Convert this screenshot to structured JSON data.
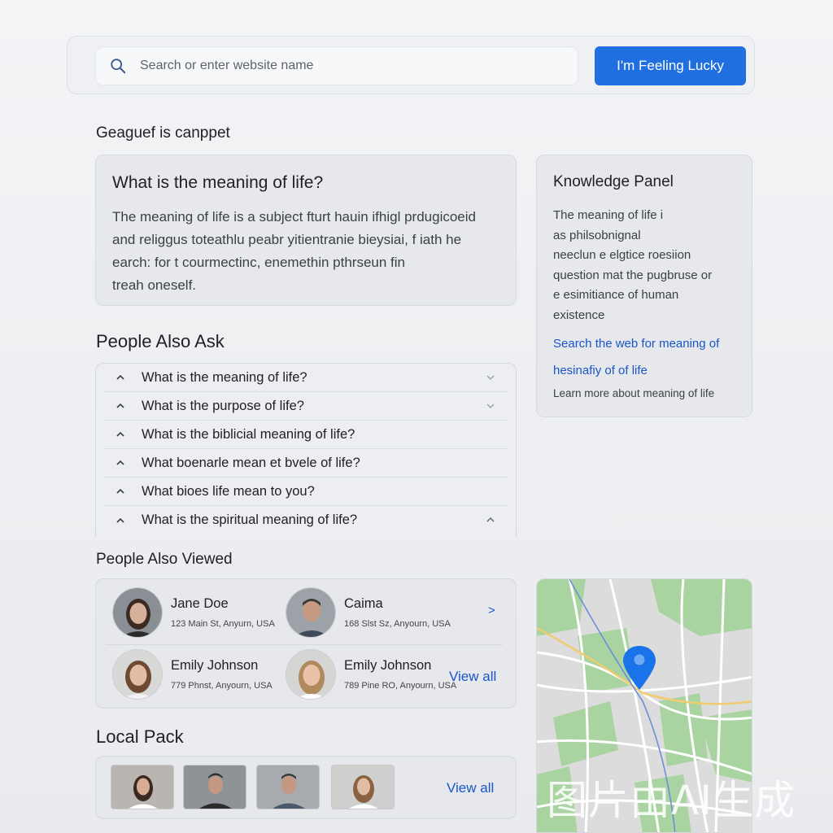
{
  "search": {
    "placeholder": "Search or enter website name",
    "lucky_label": "I'm Feeling Lucky"
  },
  "snippet_heading": "Geaguef is canppet",
  "snippet": {
    "question": "What is the meaning of life?",
    "lines": [
      "The meaning of life is a subject fturt hauin ifhigl prdugicoeid",
      "and religgus toteathlu peabr yitientranie bieysiai, f iath he",
      "earch: for t courmectinc, enemethin pthrseun fin",
      "treah oneself."
    ]
  },
  "knowledge_panel": {
    "title": "Knowledge Panel",
    "lines": [
      "The meaning of life i",
      "as philsobnignal",
      "neeclun e elgtice roesiion",
      "question mat the pugbruse or",
      "e esimitiance of human",
      "existence"
    ],
    "link_search": "Search the web for meaning of",
    "link_second": "hesinafiy of of life",
    "learn_more": "Learn more about meaning of life"
  },
  "people_also_ask": {
    "title": "People Also Ask",
    "questions": [
      "What is the meaning of life?",
      "What is the purpose of life?",
      "What is the biblicial meaning of life?",
      "What boenarle mean et bvele of life?",
      "What bioes life mean to you?",
      "What is the spiritual meaning of life?"
    ]
  },
  "people_also_viewed": {
    "title": "People Also Viewed",
    "people": [
      {
        "name": "Jane Doe",
        "address": "123 Main St, Anyurn, USA"
      },
      {
        "name": "Caima",
        "address": "168 Slst Sz, Anyourn, USA"
      },
      {
        "name": "Emily Johnson",
        "address": "779 Phnst, Anyourn, USA"
      },
      {
        "name": "Emily Johnson",
        "address": "789 Pine RO, Anyourn, USA"
      }
    ],
    "chevron": ">",
    "view_all": "View all"
  },
  "local_pack": {
    "title": "Local Pack",
    "view_all": "View all"
  },
  "watermark": "图片由AI生成",
  "colors": {
    "accent": "#1f6fe0",
    "link": "#1a55c9",
    "map_green": "#a9d3a0",
    "map_pin": "#1a73e8"
  }
}
